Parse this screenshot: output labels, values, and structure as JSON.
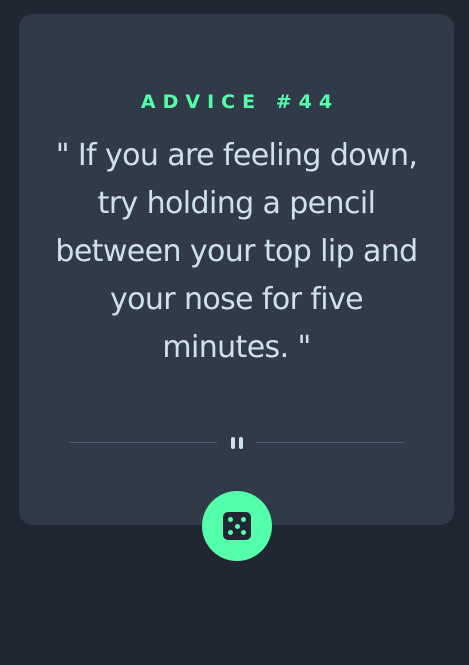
{
  "card": {
    "advice_label": "ADVICE #44",
    "quote": "\" If you are feeling down, try holding a pencil between your top lip and your nose for five minutes. \""
  },
  "icons": {
    "divider": "pause-icon",
    "button": "dice-icon"
  },
  "colors": {
    "background": "#202733",
    "card": "#313a48",
    "accent": "#53ffaa",
    "text": "#cee3e9",
    "divider": "#4f5d74"
  }
}
